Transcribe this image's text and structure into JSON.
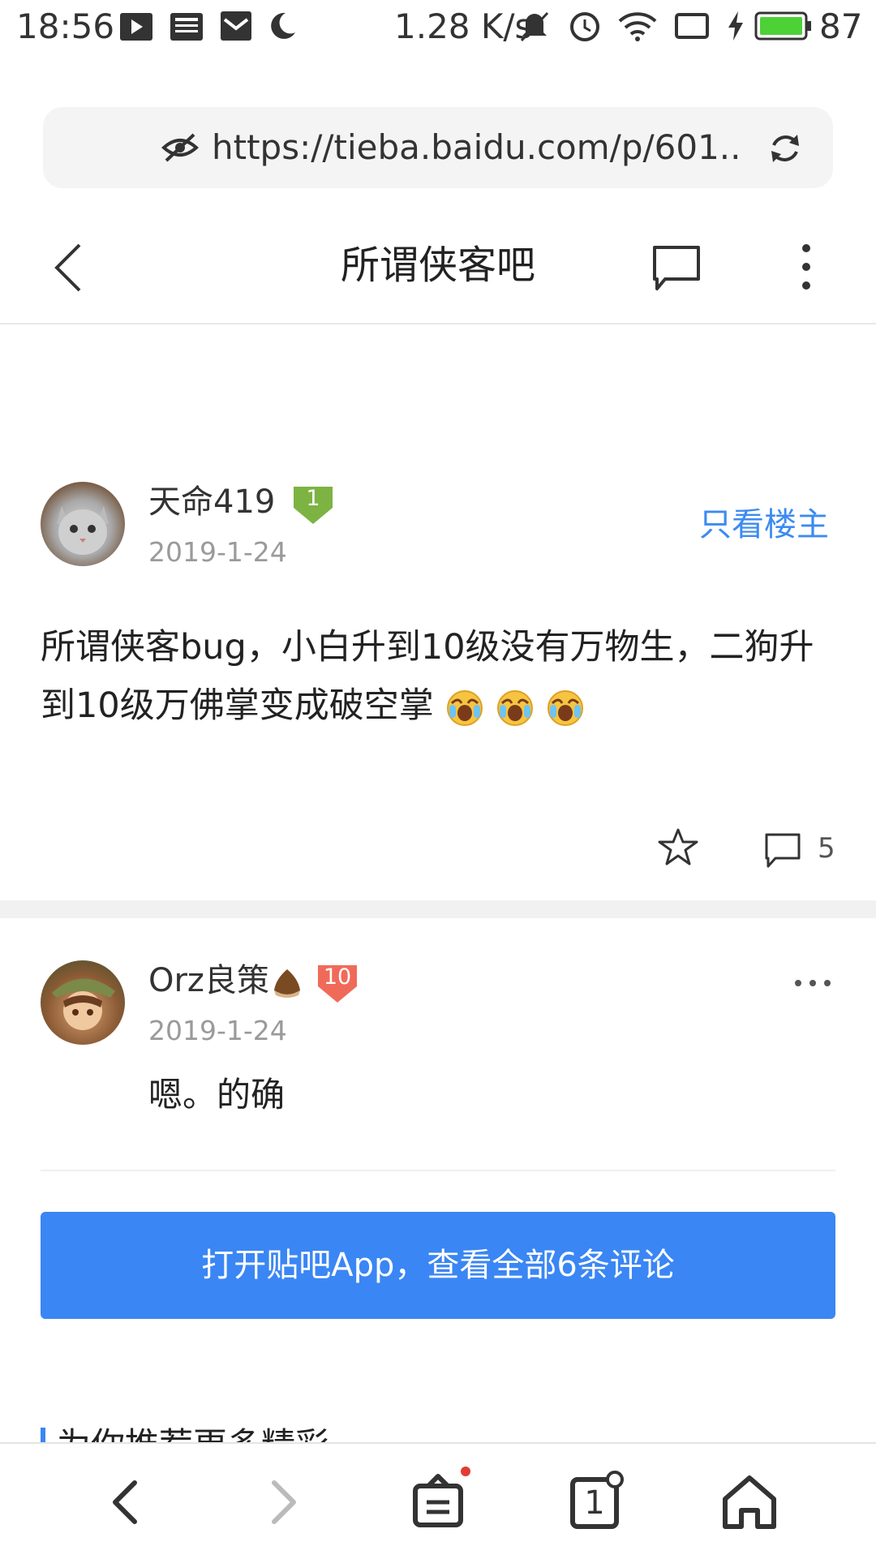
{
  "status_bar": {
    "time": "18:56",
    "net_speed": "1.28 K/s",
    "battery": "87",
    "icons": [
      "play-icon",
      "news-icon",
      "mail-icon",
      "moon-icon",
      "mute-icon",
      "alarm-icon",
      "wifi-icon",
      "screen-icon",
      "charging-icon",
      "battery-icon"
    ]
  },
  "url_bar": {
    "url": "https://tieba.baidu.com/p/601..",
    "icons": [
      "eye-slash-icon",
      "refresh-icon"
    ]
  },
  "header": {
    "title": "所谓侠客吧",
    "icons": [
      "back-arrow-icon",
      "comment-icon",
      "more-vertical-icon"
    ]
  },
  "post": {
    "author": "天命419",
    "level": "1",
    "date": "2019-1-24",
    "op_only_label": "只看楼主",
    "content": "所谓侠客bug，小白升到10级没有万物生，二狗升到10级万佛掌变成破空掌",
    "emoji_icon": "crying-emoji-icon",
    "emoji_count": 3,
    "comment_count": "5"
  },
  "reply": {
    "author": "Orz良策",
    "level": "10",
    "date": "2019-1-24",
    "content": "嗯。的确"
  },
  "open_app_button": "打开贴吧App，查看全部6条评论",
  "more_section_title": "为你推荐更多精彩",
  "bottom_nav": {
    "icons": [
      "back-icon",
      "forward-icon",
      "share-icon",
      "tabs-icon",
      "home-icon"
    ],
    "tabs_count": "1"
  },
  "colors": {
    "accent": "#3a86f4",
    "link": "#3c8bf0",
    "level_green": "#7cb342",
    "level_red": "#f06a5a"
  }
}
